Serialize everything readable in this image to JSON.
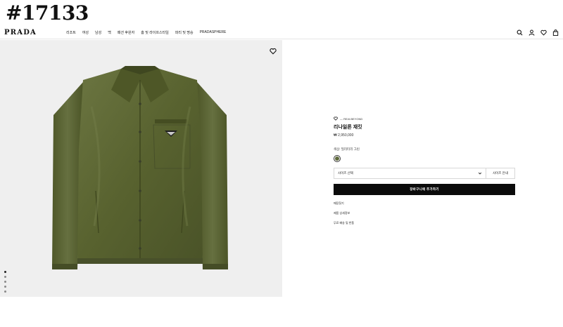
{
  "watermark": {
    "id": "#17133"
  },
  "header": {
    "logo": "PRADA",
    "nav": [
      "리조트",
      "여성",
      "남성",
      "백",
      "패션 후원자",
      "홈 및 라이프스타일",
      "파리 및 명승",
      "PRADASPHERE"
    ],
    "icons": [
      "search-icon",
      "account-icon",
      "wishlist-icon",
      "bag-icon"
    ]
  },
  "gallery": {
    "image_alt": "olive green nylon jacket",
    "image_count": 5,
    "active_index": 0
  },
  "product": {
    "breadcrumb": "— RE/A BEYOND",
    "name": "리나일론 재킷",
    "price": "₩ 2,950,000",
    "color_label": "색상: 밀리터리 그린",
    "swatch_color": "#5f6b3c",
    "size_select": "사이즈 선택",
    "size_guide": "사이즈 안내",
    "add_to_cart": "장바구니에 추가하기",
    "links": [
      "매장찾기",
      "제품 상세정보",
      "무료 배송 및 반품"
    ]
  },
  "colors": {
    "accent": "#0b0b0b",
    "jacket": "#5a6534",
    "gallery_bg": "#efefef"
  }
}
